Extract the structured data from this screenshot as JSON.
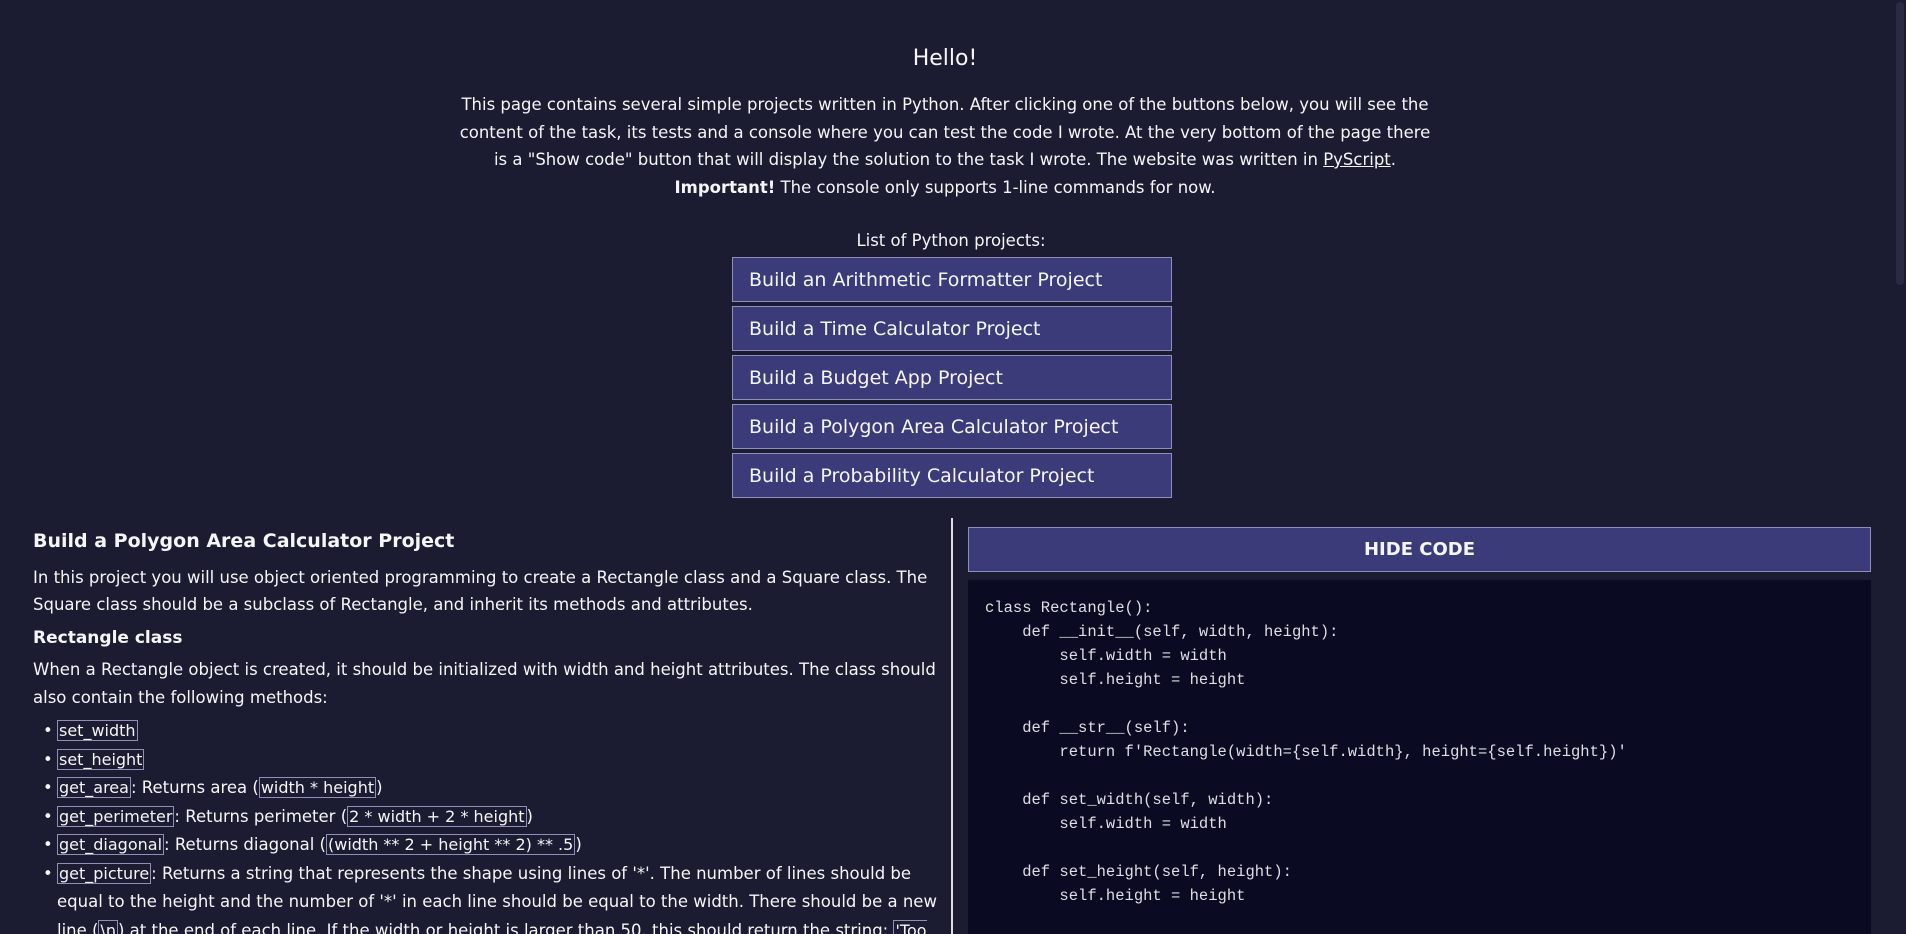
{
  "intro": {
    "title": "Hello!",
    "desc_part1": "This page contains several simple projects written in Python. After clicking one of the buttons below, you will see the content of the task, its tests and a console where you can test the code I wrote. At the very bottom of the page there is a \"Show code\" button that will display the solution to the task I wrote. The website was written in ",
    "desc_link": "PyScript",
    "desc_part2": ".",
    "important_label": "Important!",
    "important_text": " The console only supports 1-line commands for now."
  },
  "projects": {
    "heading": "List of Python projects:",
    "items": [
      "Build an Arithmetic Formatter Project",
      "Build a Time Calculator Project",
      "Build a Budget App Project",
      "Build a Polygon Area Calculator Project",
      "Build a Probability Calculator Project"
    ]
  },
  "task": {
    "title": "Build a Polygon Area Calculator Project",
    "intro": "In this project you will use object oriented programming to create a Rectangle class and a Square class. The Square class should be a subclass of Rectangle, and inherit its methods and attributes.",
    "rect_heading": "Rectangle class",
    "rect_desc": "When a Rectangle object is created, it should be initialized with width and height attributes. The class should also contain the following methods:",
    "methods": [
      {
        "name": "set_width",
        "sep": "",
        "text": "",
        "code": "",
        "tail": ""
      },
      {
        "name": "set_height",
        "sep": "",
        "text": "",
        "code": "",
        "tail": ""
      },
      {
        "name": "get_area",
        "sep": ": ",
        "text": "Returns area (",
        "code": "width * height",
        "tail": ")"
      },
      {
        "name": "get_perimeter",
        "sep": ": ",
        "text": "Returns perimeter (",
        "code": "2 * width + 2 * height",
        "tail": ")"
      },
      {
        "name": "get_diagonal",
        "sep": ": ",
        "text": "Returns diagonal (",
        "code": "(width ** 2 + height ** 2) ** .5",
        "tail": ")"
      }
    ],
    "picture_method": {
      "name": "get_picture",
      "text1": ": Returns a string that represents the shape using lines of '*'. The number of lines should be equal to the height and the number of '*' in each line should be equal to the width. There should be a new line (",
      "code1": "\\n",
      "text2": ") at the end of each line. If the width or height is larger than 50, this should return the string: ",
      "code2": "'Too big for picture.'"
    }
  },
  "code_panel": {
    "button_label": "HIDE CODE",
    "code": "class Rectangle():\n    def __init__(self, width, height):\n        self.width = width\n        self.height = height\n\n    def __str__(self):\n        return f'Rectangle(width={self.width}, height={self.height})'\n\n    def set_width(self, width):\n        self.width = width\n\n    def set_height(self, height):\n        self.height = height\n\n    def get_area(self):\n        return self.width * self.height"
  },
  "colors": {
    "background": "#1b1b32",
    "button": "#3b3b79",
    "button_border": "#8f8fb9",
    "code_background": "#0a0a23",
    "text": "#f5f6f7"
  }
}
